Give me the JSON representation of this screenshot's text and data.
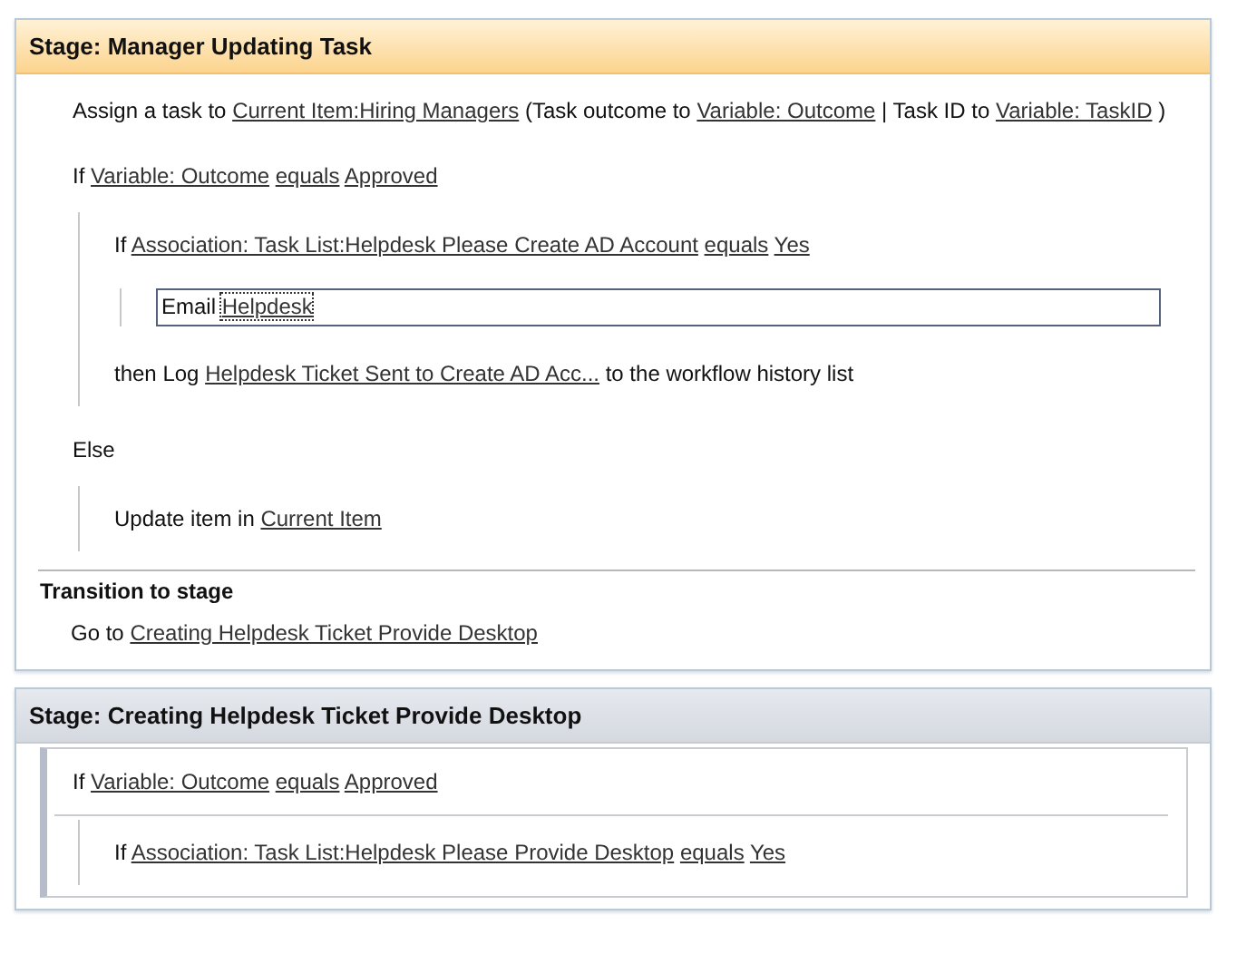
{
  "stages": [
    {
      "title": "Stage: Manager Updating Task",
      "selected": true,
      "steps": [
        {
          "selected": false,
          "framed": false,
          "parts": [
            {
              "text": "Assign a task to",
              "link": false
            },
            {
              "text": "Current Item:Hiring Managers",
              "link": true
            },
            {
              "text": "(Task outcome to",
              "link": false
            },
            {
              "text": "Variable: Outcome",
              "link": true
            },
            {
              "text": "| Task ID to",
              "link": false
            },
            {
              "text": "Variable: TaskID",
              "link": true
            },
            {
              "text": ")",
              "link": false
            }
          ]
        },
        {
          "selected": false,
          "framed": false,
          "parts": [
            {
              "text": "If",
              "link": false
            },
            {
              "text": "Variable: Outcome",
              "link": true
            },
            {
              "text": "equals",
              "link": true
            },
            {
              "text": "Approved",
              "link": true
            }
          ],
          "children": [
            {
              "selected": false,
              "framed": false,
              "parts": [
                {
                  "text": "If",
                  "link": false
                },
                {
                  "text": "Association: Task List:Helpdesk Please Create AD Account",
                  "link": true
                },
                {
                  "text": "equals",
                  "link": true
                },
                {
                  "text": "Yes",
                  "link": true
                }
              ],
              "children": [
                {
                  "selected": true,
                  "framed": false,
                  "parts": [
                    {
                      "text": "Email",
                      "link": false
                    },
                    {
                      "text": "Helpdesk",
                      "link": true
                    }
                  ]
                }
              ]
            },
            {
              "selected": false,
              "framed": false,
              "parts": [
                {
                  "text": "then Log",
                  "link": false
                },
                {
                  "text": "Helpdesk Ticket Sent to Create AD Acc...",
                  "link": true
                },
                {
                  "text": "to the workflow history list",
                  "link": false
                }
              ]
            }
          ]
        },
        {
          "selected": false,
          "framed": false,
          "parts": [
            {
              "text": "Else",
              "link": false
            }
          ],
          "children": [
            {
              "selected": false,
              "framed": false,
              "parts": [
                {
                  "text": "Update item in",
                  "link": false
                },
                {
                  "text": "Current Item",
                  "link": true
                }
              ]
            }
          ]
        }
      ],
      "transition": {
        "heading": "Transition to stage",
        "parts": [
          {
            "text": "Go to",
            "link": false
          },
          {
            "text": "Creating Helpdesk Ticket Provide Desktop",
            "link": true
          }
        ]
      }
    },
    {
      "title": "Stage: Creating Helpdesk Ticket Provide Desktop",
      "selected": false,
      "steps": [
        {
          "selected": false,
          "framed": true,
          "parts": [
            {
              "text": "If",
              "link": false
            },
            {
              "text": "Variable: Outcome",
              "link": true
            },
            {
              "text": "equals",
              "link": true
            },
            {
              "text": "Approved",
              "link": true
            }
          ],
          "children": [
            {
              "selected": false,
              "framed": false,
              "parts": [
                {
                  "text": "If",
                  "link": false
                },
                {
                  "text": "Association: Task List:Helpdesk Please Provide Desktop",
                  "link": true
                },
                {
                  "text": "equals",
                  "link": true
                },
                {
                  "text": "Yes",
                  "link": true
                }
              ]
            }
          ]
        }
      ]
    }
  ]
}
